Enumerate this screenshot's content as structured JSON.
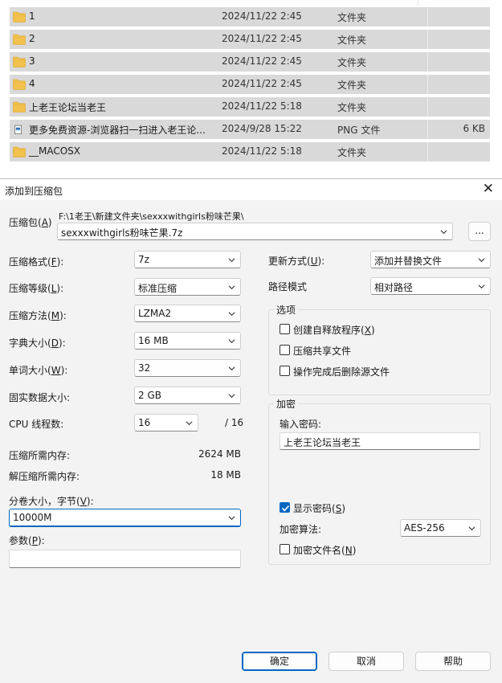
{
  "files": [
    {
      "name": "1",
      "date": "2024/11/22 2:45",
      "type": "文件夹",
      "size": "",
      "icon": "folder-icon"
    },
    {
      "name": "2",
      "date": "2024/11/22 2:45",
      "type": "文件夹",
      "size": "",
      "icon": "folder-icon"
    },
    {
      "name": "3",
      "date": "2024/11/22 2:45",
      "type": "文件夹",
      "size": "",
      "icon": "folder-icon"
    },
    {
      "name": "4",
      "date": "2024/11/22 2:45",
      "type": "文件夹",
      "size": "",
      "icon": "folder-icon"
    },
    {
      "name": "上老王论坛当老王",
      "date": "2024/11/22 5:18",
      "type": "文件夹",
      "size": "",
      "icon": "folder-icon"
    },
    {
      "name": "更多免费资源-浏览器扫一扫进入老王论...",
      "date": "2024/9/28 15:22",
      "type": "PNG 文件",
      "size": "6 KB",
      "icon": "image-file-icon"
    },
    {
      "name": "__MACOSX",
      "date": "2024/11/22 5:18",
      "type": "文件夹",
      "size": "",
      "icon": "folder-icon"
    }
  ],
  "dialog": {
    "title": "添加到压缩包",
    "archive": {
      "label": "压缩包",
      "key": "A",
      "path": "F:\\1老王\\新建文件夹\\sexxxwithgirls粉味芒果\\",
      "filename": "sexxxwithgirls粉味芒果.7z",
      "browse": "..."
    },
    "left": {
      "format": {
        "label": "压缩格式",
        "key": "F",
        "value": "7z"
      },
      "level": {
        "label": "压缩等级",
        "key": "L",
        "value": "标准压缩"
      },
      "method": {
        "label": "压缩方法",
        "key": "M",
        "value": "LZMA2"
      },
      "dict": {
        "label": "字典大小",
        "key": "D",
        "value": "16 MB"
      },
      "word": {
        "label": "单词大小",
        "key": "W",
        "value": "32"
      },
      "solid": {
        "label": "固实数据大小",
        "suffix": ":",
        "value": "2 GB"
      },
      "cpu": {
        "label": "CPU 线程数",
        "suffix": ":",
        "value": "16",
        "total": "/ 16"
      },
      "mem_comp": {
        "label": "压缩所需内存:",
        "value": "2624 MB"
      },
      "mem_decomp": {
        "label": "解压缩所需内存:",
        "value": "18 MB"
      },
      "volume": {
        "label": "分卷大小，字节",
        "key": "V",
        "value": "10000M"
      },
      "params": {
        "label": "参数",
        "key": "P",
        "value": ""
      }
    },
    "right": {
      "update": {
        "label": "更新方式",
        "key": "U",
        "value": "添加并替换文件"
      },
      "path_mode": {
        "label": "路径模式",
        "value": "相对路径"
      },
      "options": {
        "title": "选项",
        "sfx": {
          "label": "创建自释放程序",
          "key": "X",
          "checked": false
        },
        "shared": {
          "label": "压缩共享文件",
          "checked": false
        },
        "delete": {
          "label": "操作完成后删除源文件",
          "checked": false
        }
      },
      "encryption": {
        "title": "加密",
        "pwd_label": "输入密码:",
        "password": "上老王论坛当老王",
        "show_pwd": {
          "label": "显示密码",
          "key": "S",
          "checked": true
        },
        "algo_label": "加密算法:",
        "algo": "AES-256",
        "encrypt_names": {
          "label": "加密文件名",
          "key": "N",
          "checked": false
        }
      }
    },
    "buttons": {
      "ok": "确定",
      "cancel": "取消",
      "help": "帮助"
    },
    "colors": {
      "accent": "#0067c0",
      "row_bg": "#d9d9d9",
      "dialog_bg": "#f3f3f3",
      "folder": "#f2c14e"
    }
  }
}
